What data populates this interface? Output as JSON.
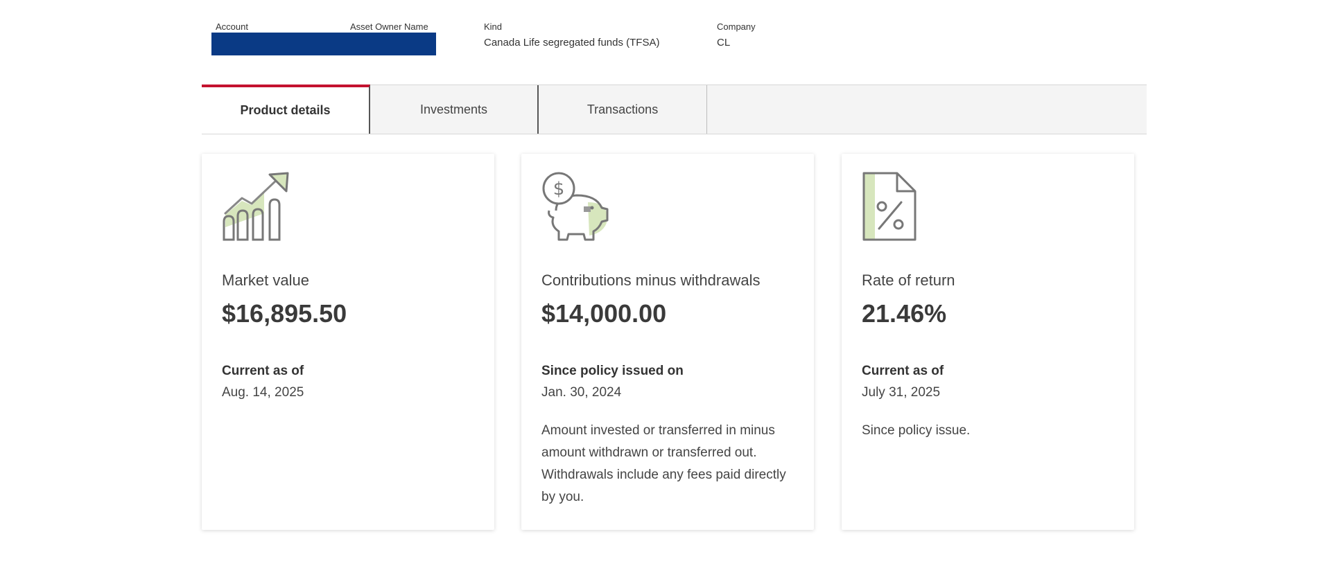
{
  "account_header": {
    "account_label": "Account",
    "owner_label": "Asset Owner Name",
    "kind_label": "Kind",
    "kind_value": "Canada Life segregated funds (TFSA)",
    "company_label": "Company",
    "company_value": "CL",
    "redaction_color": "#0a3a85"
  },
  "tabs": [
    {
      "label": "Product details",
      "active": true
    },
    {
      "label": "Investments",
      "active": false
    },
    {
      "label": "Transactions",
      "active": false
    }
  ],
  "colors": {
    "accent": "#c4122f",
    "icon_fill": "#d7e6bd",
    "icon_stroke": "#777777"
  },
  "cards": [
    {
      "icon": "growth-chart-icon",
      "title": "Market value",
      "amount": "$16,895.50",
      "sub_label": "Current as of",
      "sub_value": "Aug. 14, 2025",
      "description": ""
    },
    {
      "icon": "piggy-bank-icon",
      "title": "Contributions minus withdrawals",
      "amount": "$14,000.00",
      "sub_label": "Since policy issued on",
      "sub_value": "Jan. 30, 2024",
      "description": "Amount invested or transferred in minus amount withdrawn or transferred out. Withdrawals include any fees paid directly by you."
    },
    {
      "icon": "percent-document-icon",
      "title": "Rate of return",
      "amount": "21.46%",
      "sub_label": "Current as of",
      "sub_value": "July 31, 2025",
      "description": "Since policy issue."
    }
  ]
}
